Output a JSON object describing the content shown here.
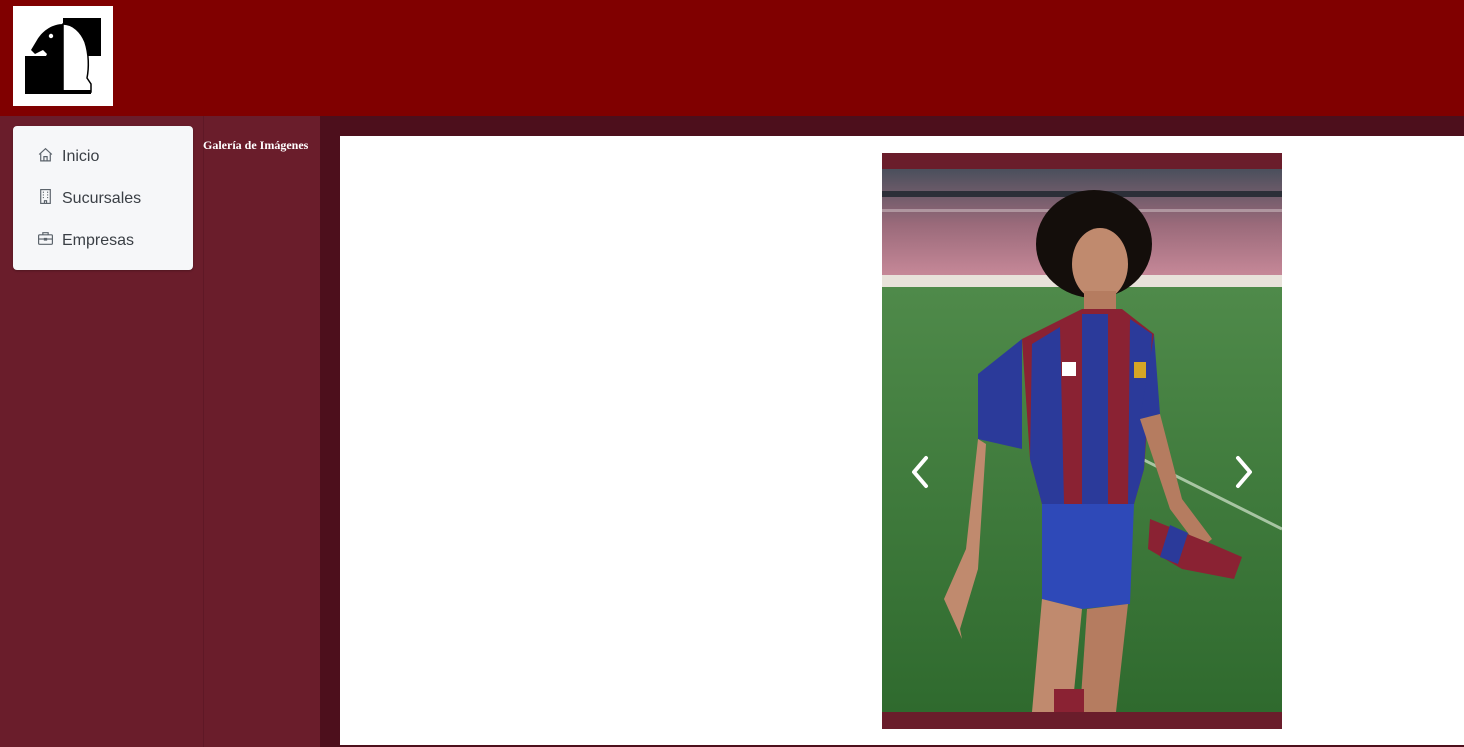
{
  "app": {
    "logo_icon": "chess-knight-logo"
  },
  "nav": {
    "items": [
      {
        "label": "Inicio",
        "icon": "home-icon"
      },
      {
        "label": "Sucursales",
        "icon": "building-icon"
      },
      {
        "label": "Empresas",
        "icon": "briefcase-icon"
      }
    ]
  },
  "gallery": {
    "title": "Galería de Imágenes",
    "prev_icon": "chevron-left-icon",
    "next_icon": "chevron-right-icon"
  },
  "colors": {
    "header": "#800000",
    "sidebar": "#6a1d2b",
    "content_bg": "#4d0f1c",
    "panel": "#ffffff"
  }
}
